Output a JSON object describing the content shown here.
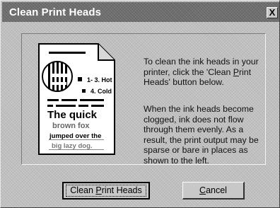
{
  "window": {
    "title": "Clean Print Heads",
    "close_label": "X"
  },
  "illustration": {
    "icon": "print-sample-document-icon",
    "label_1": "1- 3. Hot",
    "label_2": "4. Cold",
    "line_1": "The quick",
    "line_2": "brown fox",
    "line_3": "jumped over the",
    "line_4": "big lazy dog."
  },
  "description": {
    "paragraph_1_before": "To clean the ink heads in your printer, click the 'Clean ",
    "paragraph_1_accel": "P",
    "paragraph_1_after": "rint Heads' button below.",
    "paragraph_2": "When the ink heads become clogged, ink does not flow through them evenly.  As a result, the print output may be sparse or bare in places as shown to the left."
  },
  "buttons": {
    "clean_before": "Clean ",
    "clean_accel": "P",
    "clean_after": "rint Heads",
    "cancel_accel": "C",
    "cancel_after": "ancel"
  }
}
